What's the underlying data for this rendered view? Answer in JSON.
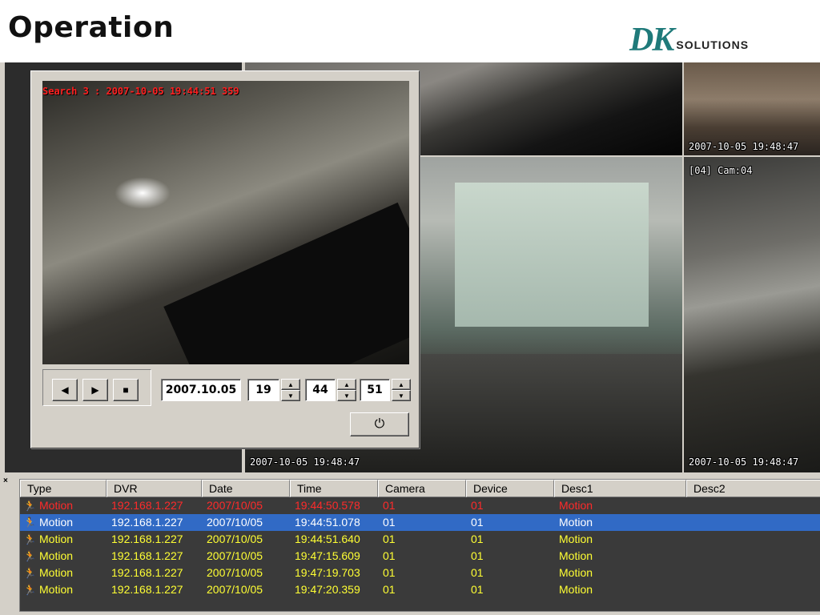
{
  "slide": {
    "title": "Operation"
  },
  "logo": {
    "mark": "DK",
    "text": "SOLUTIONS"
  },
  "cameras": {
    "top_right_stamp": "2007-10-05 19:48:47",
    "street_label": "[04] Cam:04",
    "room_stamp": "2007-10-05 19:48:47",
    "street_stamp": "2007-10-05 19:48:47"
  },
  "search": {
    "stamp": "Search 3 : 2007-10-05 19:44:51 359",
    "date": "2007.10.05",
    "hour": "19",
    "minute": "44",
    "second": "51",
    "rewind_glyph": "◀",
    "play_glyph": "▶",
    "stop_glyph": "■",
    "up_glyph": "▲",
    "down_glyph": "▼",
    "power_glyph": "⏻"
  },
  "events": {
    "close_glyph": "×",
    "columns": [
      "Type",
      "DVR",
      "Date",
      "Time",
      "Camera",
      "Device",
      "Desc1",
      "Desc2"
    ],
    "rows": [
      {
        "type": "Motion",
        "dvr": "192.168.1.227",
        "date": "2007/10/05",
        "time": "19:44:50.578",
        "camera": "01",
        "device": "01",
        "desc1": "Motion",
        "desc2": "",
        "state": "alert"
      },
      {
        "type": "Motion",
        "dvr": "192.168.1.227",
        "date": "2007/10/05",
        "time": "19:44:51.078",
        "camera": "01",
        "device": "01",
        "desc1": "Motion",
        "desc2": "",
        "state": "selected"
      },
      {
        "type": "Motion",
        "dvr": "192.168.1.227",
        "date": "2007/10/05",
        "time": "19:44:51.640",
        "camera": "01",
        "device": "01",
        "desc1": "Motion",
        "desc2": "",
        "state": "normal"
      },
      {
        "type": "Motion",
        "dvr": "192.168.1.227",
        "date": "2007/10/05",
        "time": "19:47:15.609",
        "camera": "01",
        "device": "01",
        "desc1": "Motion",
        "desc2": "",
        "state": "normal"
      },
      {
        "type": "Motion",
        "dvr": "192.168.1.227",
        "date": "2007/10/05",
        "time": "19:47:19.703",
        "camera": "01",
        "device": "01",
        "desc1": "Motion",
        "desc2": "",
        "state": "normal"
      },
      {
        "type": "Motion",
        "dvr": "192.168.1.227",
        "date": "2007/10/05",
        "time": "19:47:20.359",
        "camera": "01",
        "device": "01",
        "desc1": "Motion",
        "desc2": "",
        "state": "normal"
      }
    ]
  },
  "colors": {
    "selected": "#316ac5",
    "alert": "#ff2a2a",
    "normal": "#ffff33",
    "brand": "#1f7a7a"
  }
}
